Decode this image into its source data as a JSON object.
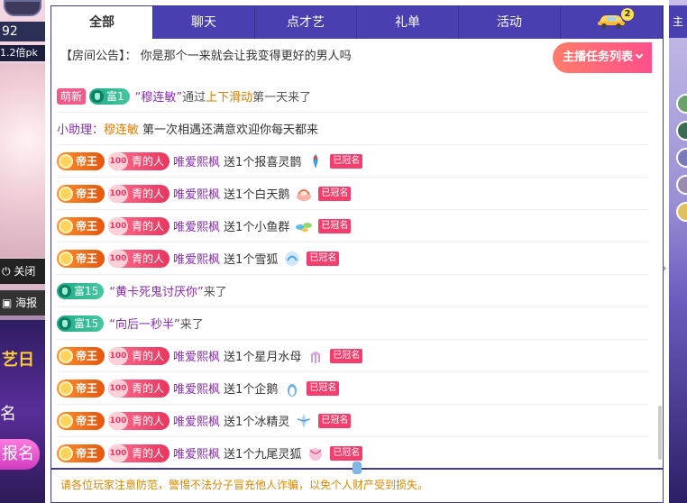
{
  "left": {
    "count": "92",
    "pk": "1.2倍pk",
    "close_label": "关闭",
    "poster_label": "海报",
    "promo_line1": "艺日",
    "promo_line2": "名",
    "promo_btn": "报名"
  },
  "tabs": [
    {
      "label": "全部",
      "active": true
    },
    {
      "label": "聊天"
    },
    {
      "label": "点才艺"
    },
    {
      "label": "礼单"
    },
    {
      "label": "活动"
    },
    {
      "label": "",
      "icon": "car-icon",
      "badge": "2"
    }
  ],
  "announce": {
    "tag": "【房间公告】：",
    "text": "你是那个一来就会让我变得更好的男人吗"
  },
  "task_button": "主播任务列表",
  "entry": {
    "badge1": "萌新",
    "badge2": "富1",
    "name": "“穆连敏”",
    "via": "通过",
    "method": "上下滑动",
    "suffix": "第一天来了"
  },
  "assistant": {
    "label": "小助理：",
    "name": "穆连敏",
    "text": "第一次相遇还满意欢迎你每天都来"
  },
  "gift_msgs": [
    {
      "gift": "送1个报喜灵鹊"
    },
    {
      "gift": "送1个白天鹅"
    },
    {
      "gift": "送1个小鱼群"
    },
    {
      "gift": "送1个雪狐"
    },
    {
      "gift": "送1个星月水母"
    },
    {
      "gift": "送1个企鹅"
    },
    {
      "gift": "送1个冰精灵"
    },
    {
      "gift": "送1个九尾灵狐"
    }
  ],
  "badges": {
    "emperor": "帝王",
    "qing_num": "100",
    "qing_label": "青的人",
    "sender": "唯爱熙枫",
    "crowned": "已冠名",
    "fu15": "富15"
  },
  "enter15": [
    {
      "name": "“黄卡死鬼讨厌你”",
      "suffix": "来了"
    },
    {
      "name": "“向后一秒半”",
      "suffix": "来了"
    }
  ],
  "notice": "请各位玩家注意防范，警惕不法分子冒充他人诈骗，以免个人财产受到损失。",
  "right": {
    "head": "主"
  }
}
